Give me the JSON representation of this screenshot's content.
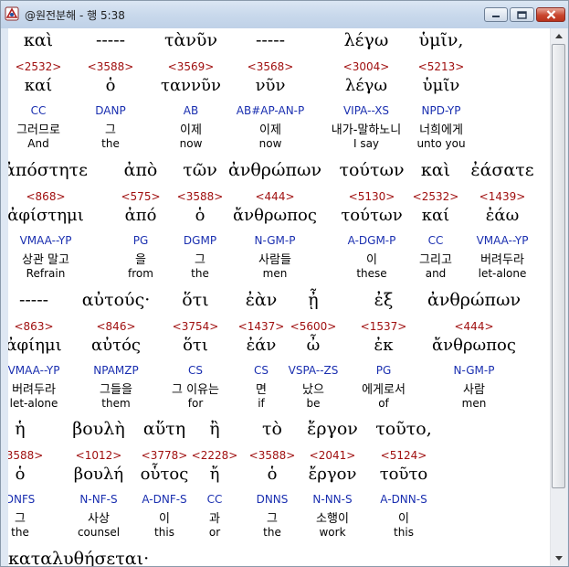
{
  "window": {
    "title": "@원전분해 - 행 5:38"
  },
  "content": {
    "lines": [
      {
        "row": 1,
        "words": [
          {
            "greek": "καὶ",
            "strong": "<2532>",
            "lemma": "καί",
            "parse": "CC",
            "korean": "그러므로",
            "english": "And"
          },
          {
            "greek": "-----",
            "strong": "<3588>",
            "lemma": "ὁ",
            "parse": "DANP",
            "korean": "그",
            "english": "the"
          },
          {
            "greek": "τὰνῦν",
            "strong": "<3569>",
            "lemma": "ταννῦν",
            "parse": "AB",
            "korean": "이제",
            "english": "now"
          },
          {
            "greek": "-----",
            "strong": "<3568>",
            "lemma": "νῦν",
            "parse": "AB#AP-AN-P",
            "korean": "이제",
            "english": "now"
          },
          {
            "greek": "λέγω",
            "strong": "<3004>",
            "lemma": "λέγω",
            "parse": "VIPA--XS",
            "korean": "내가-말하노니",
            "english": "I say"
          },
          {
            "greek": "ὑμῖν,",
            "strong": "<5213>",
            "lemma": "ὑμῖν",
            "parse": "NPD-YP",
            "korean": "너희에게",
            "english": "unto you"
          }
        ]
      },
      {
        "row": 2,
        "words": [
          {
            "greek": "ἀπόστητε",
            "strong": "<868>",
            "lemma": "ἀφίστημι",
            "parse": "VMAA--YP",
            "korean": "상관 말고",
            "english": "Refrain"
          },
          {
            "greek": "ἀπὸ",
            "strong": "<575>",
            "lemma": "ἀπό",
            "parse": "PG",
            "korean": "을",
            "english": "from"
          },
          {
            "greek": "τῶν",
            "strong": "<3588>",
            "lemma": "ὁ",
            "parse": "DGMP",
            "korean": "그",
            "english": "the"
          },
          {
            "greek": "ἀνθρώπων",
            "strong": "<444>",
            "lemma": "ἄνθρωπος",
            "parse": "N-GM-P",
            "korean": "사람들",
            "english": "men"
          },
          {
            "greek": "τούτων",
            "strong": "<5130>",
            "lemma": "τούτων",
            "parse": "A-DGM-P",
            "korean": "이",
            "english": "these"
          },
          {
            "greek": "καὶ",
            "strong": "<2532>",
            "lemma": "καί",
            "parse": "CC",
            "korean": "그리고",
            "english": "and"
          },
          {
            "greek": "ἐάσατε",
            "strong": "<1439>",
            "lemma": "ἐάω",
            "parse": "VMAA--YP",
            "korean": "버려두라",
            "english": "let-alone"
          }
        ]
      },
      {
        "row": 3,
        "words": [
          {
            "greek": "-----",
            "strong": "<863>",
            "lemma": "ἀφίημι",
            "parse": "VMAA--YP",
            "korean": "버려두라",
            "english": "let-alone"
          },
          {
            "greek": "αὐτούς·",
            "strong": "<846>",
            "lemma": "αὐτός",
            "parse": "NPAMZP",
            "korean": "그들을",
            "english": "them"
          },
          {
            "greek": "ὅτι",
            "strong": "<3754>",
            "lemma": "ὅτι",
            "parse": "CS",
            "korean": "그 이유는",
            "english": "for"
          },
          {
            "greek": "ἐὰν",
            "strong": "<1437>",
            "lemma": "ἐάν",
            "parse": "CS",
            "korean": "면",
            "english": "if"
          },
          {
            "greek": "ᾖ",
            "strong": "<5600>",
            "lemma": "ὦ",
            "parse": "VSPA--ZS",
            "korean": "났으",
            "english": "be"
          },
          {
            "greek": "ἐξ",
            "strong": "<1537>",
            "lemma": "ἐκ",
            "parse": "PG",
            "korean": "에게로서",
            "english": "of"
          },
          {
            "greek": "ἀνθρώπων",
            "strong": "<444>",
            "lemma": "ἄνθρωπος",
            "parse": "N-GM-P",
            "korean": "사람",
            "english": "men"
          }
        ]
      },
      {
        "row": 4,
        "words": [
          {
            "greek": "ἡ",
            "strong": "<3588>",
            "lemma": "ὁ",
            "parse": "DNFS",
            "korean": "그",
            "english": "the"
          },
          {
            "greek": "βουλὴ",
            "strong": "<1012>",
            "lemma": "βουλή",
            "parse": "N-NF-S",
            "korean": "사상",
            "english": "counsel"
          },
          {
            "greek": "αὕτη",
            "strong": "<3778>",
            "lemma": "οὗτος",
            "parse": "A-DNF-S",
            "korean": "이",
            "english": "this"
          },
          {
            "greek": "ἢ",
            "strong": "<2228>",
            "lemma": "ἤ",
            "parse": "CC",
            "korean": "과",
            "english": "or"
          },
          {
            "greek": "τὸ",
            "strong": "<3588>",
            "lemma": "ὁ",
            "parse": "DNNS",
            "korean": "그",
            "english": "the"
          },
          {
            "greek": "ἔργον",
            "strong": "<2041>",
            "lemma": "ἔργον",
            "parse": "N-NN-S",
            "korean": "소행이",
            "english": "work"
          },
          {
            "greek": "τοῦτο,",
            "strong": "<5124>",
            "lemma": "τοῦτο",
            "parse": "A-DNN-S",
            "korean": "이",
            "english": "this"
          }
        ]
      }
    ],
    "trailing_line": "καταλυθήσεται·"
  },
  "colors": {
    "strong_number": "#a01010",
    "parse_code": "#1a2fb0",
    "window_frame": "#dfe8f3",
    "close_button": "#c8462e"
  },
  "icons": {
    "app": "app-logo-icon",
    "minimize": "minimize-icon",
    "maximize": "maximize-icon",
    "close": "close-icon",
    "scroll_up": "scroll-up-arrow-icon",
    "scroll_down": "scroll-down-arrow-icon"
  }
}
